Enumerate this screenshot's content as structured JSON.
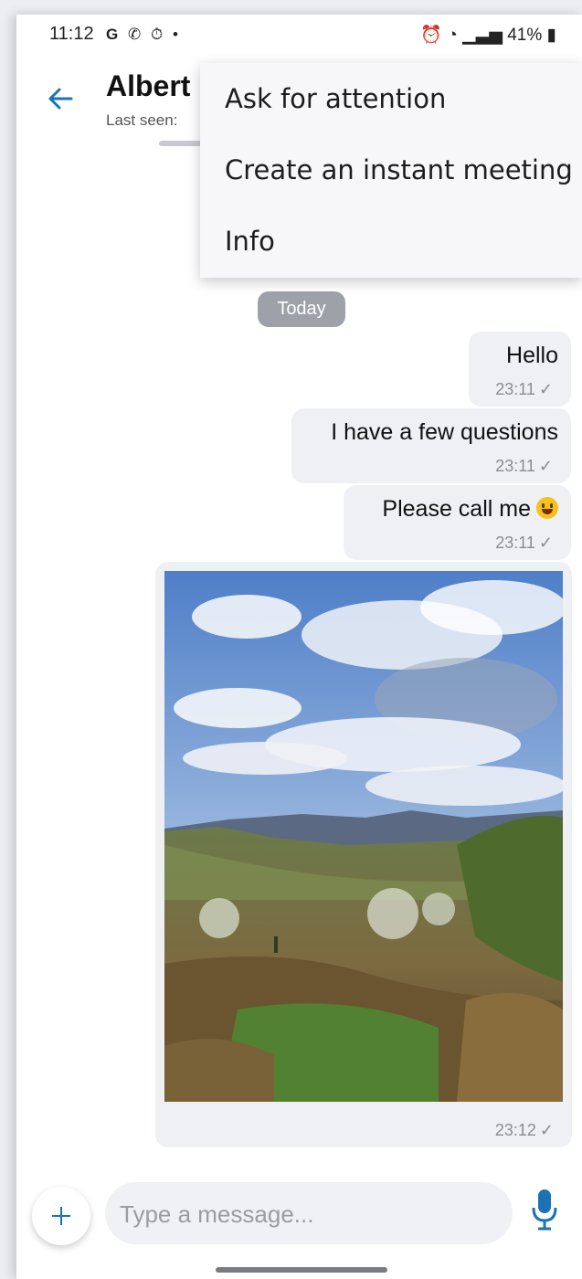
{
  "status_bar": {
    "time": "11:12",
    "notification_icons": [
      "G",
      "viber-icon",
      "timer-icon",
      "•"
    ],
    "right_text": "41%"
  },
  "header": {
    "contact_name": "Albert",
    "last_seen": "Last seen:"
  },
  "menu": {
    "items": [
      "Ask for attention",
      "Create an instant meeting",
      "Info"
    ]
  },
  "chat": {
    "date_chip": "Today",
    "messages": [
      {
        "text": "Hello",
        "time": "23:11"
      },
      {
        "text": "I have a few questions",
        "time": "23:11"
      },
      {
        "text": "Please call me",
        "time": "23:11",
        "emoji": "grinning-face-with-tongue"
      },
      {
        "type": "image",
        "description": "landscape photo",
        "time": "23:12"
      }
    ],
    "tick": "✓"
  },
  "composer": {
    "placeholder": "Type a message..."
  },
  "colors": {
    "accent": "#1a73b5",
    "bubble": "#eef0f4",
    "chip": "#9ea1a9"
  }
}
